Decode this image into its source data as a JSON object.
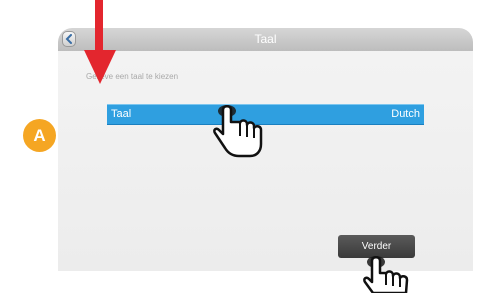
{
  "titlebar": {
    "title": "Taal",
    "back_icon": "chevron-left-icon"
  },
  "prompt": "Gelieve een taal te kiezen",
  "language_row": {
    "label": "Taal",
    "value": "Dutch"
  },
  "next_button": {
    "label": "Verder"
  },
  "annotation": {
    "badge_letter": "A",
    "arrow_color": "#e3262e",
    "badge_color": "#f5a623"
  },
  "colors": {
    "selection": "#2f9fe0",
    "titlebar": "#c8c8c8",
    "button": "#474747"
  }
}
